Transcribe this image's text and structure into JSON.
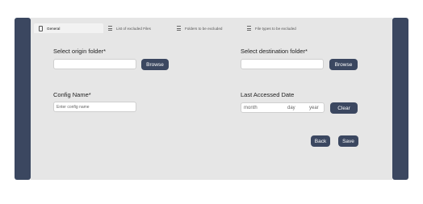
{
  "tabs": [
    {
      "label": "General",
      "icon": "phone-icon",
      "active": true
    },
    {
      "label": "List of excluded Files",
      "icon": "list-icon",
      "active": false
    },
    {
      "label": "Folders to be excluded",
      "icon": "list-icon",
      "active": false
    },
    {
      "label": "File types to be excluded",
      "icon": "list-icon",
      "active": false
    }
  ],
  "origin": {
    "label": "Select origin folder*",
    "value": "",
    "browse_label": "Browse"
  },
  "destination": {
    "label": "Select destination folder*",
    "value": "",
    "browse_label": "Browse"
  },
  "config": {
    "label": "Config Name*",
    "placeholder": "Enter config name"
  },
  "last_accessed": {
    "label": "Last Accessed Date",
    "month": "month",
    "day": "day",
    "year": "year",
    "clear_label": "Clear"
  },
  "actions": {
    "back_label": "Back",
    "save_label": "Save"
  },
  "colors": {
    "accent": "#3b4760",
    "panel": "#e6e6e6"
  }
}
